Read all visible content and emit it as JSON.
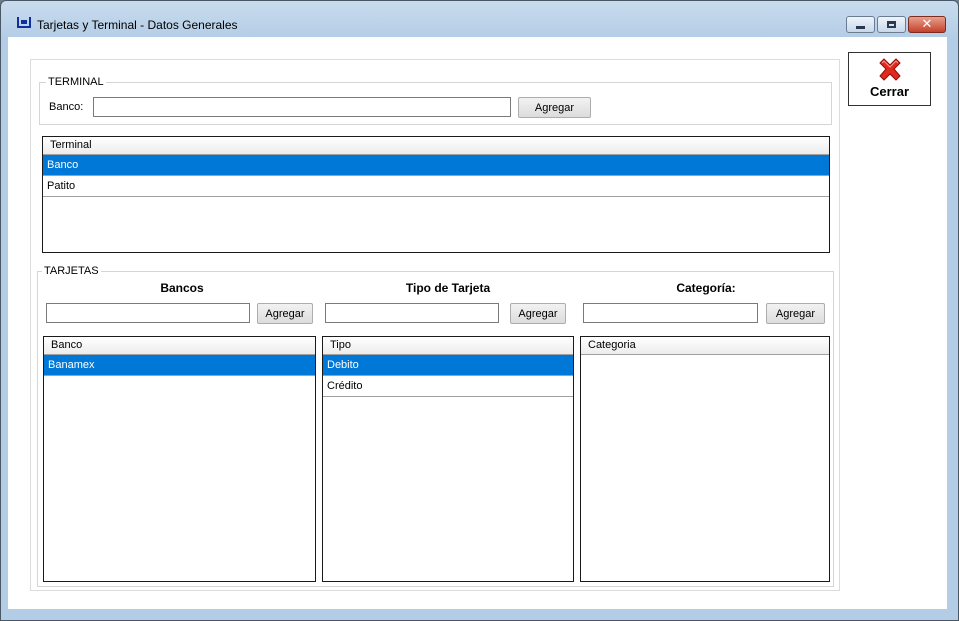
{
  "window": {
    "title": "Tarjetas y Terminal - Datos Generales",
    "close_glyph": "✕"
  },
  "close_button": {
    "label": "Cerrar",
    "icon": "red-x-icon"
  },
  "terminal": {
    "group_title": "TERMINAL",
    "banco_label": "Banco:",
    "banco_value": "",
    "add_label": "Agregar",
    "list": {
      "header": "Terminal",
      "rows": [
        {
          "text": "Banco",
          "selected": true
        },
        {
          "text": "Patito",
          "selected": false
        }
      ]
    }
  },
  "tarjetas": {
    "group_title": "TARJETAS",
    "bancos": {
      "heading": "Bancos",
      "input_value": "",
      "add_label": "Agregar",
      "header": "Banco",
      "rows": [
        {
          "text": "Banamex",
          "selected": true
        }
      ]
    },
    "tipo": {
      "heading": "Tipo de Tarjeta",
      "input_value": "",
      "add_label": "Agregar",
      "header": "Tipo",
      "rows": [
        {
          "text": "Debito",
          "selected": true
        },
        {
          "text": "Crédito",
          "selected": false
        }
      ]
    },
    "categoria": {
      "heading": "Categoría:",
      "input_value": "",
      "add_label": "Agregar",
      "header": "Categoria",
      "rows": []
    }
  },
  "colors": {
    "selection": "#0078d7",
    "close_button_red": "#c4412c"
  }
}
